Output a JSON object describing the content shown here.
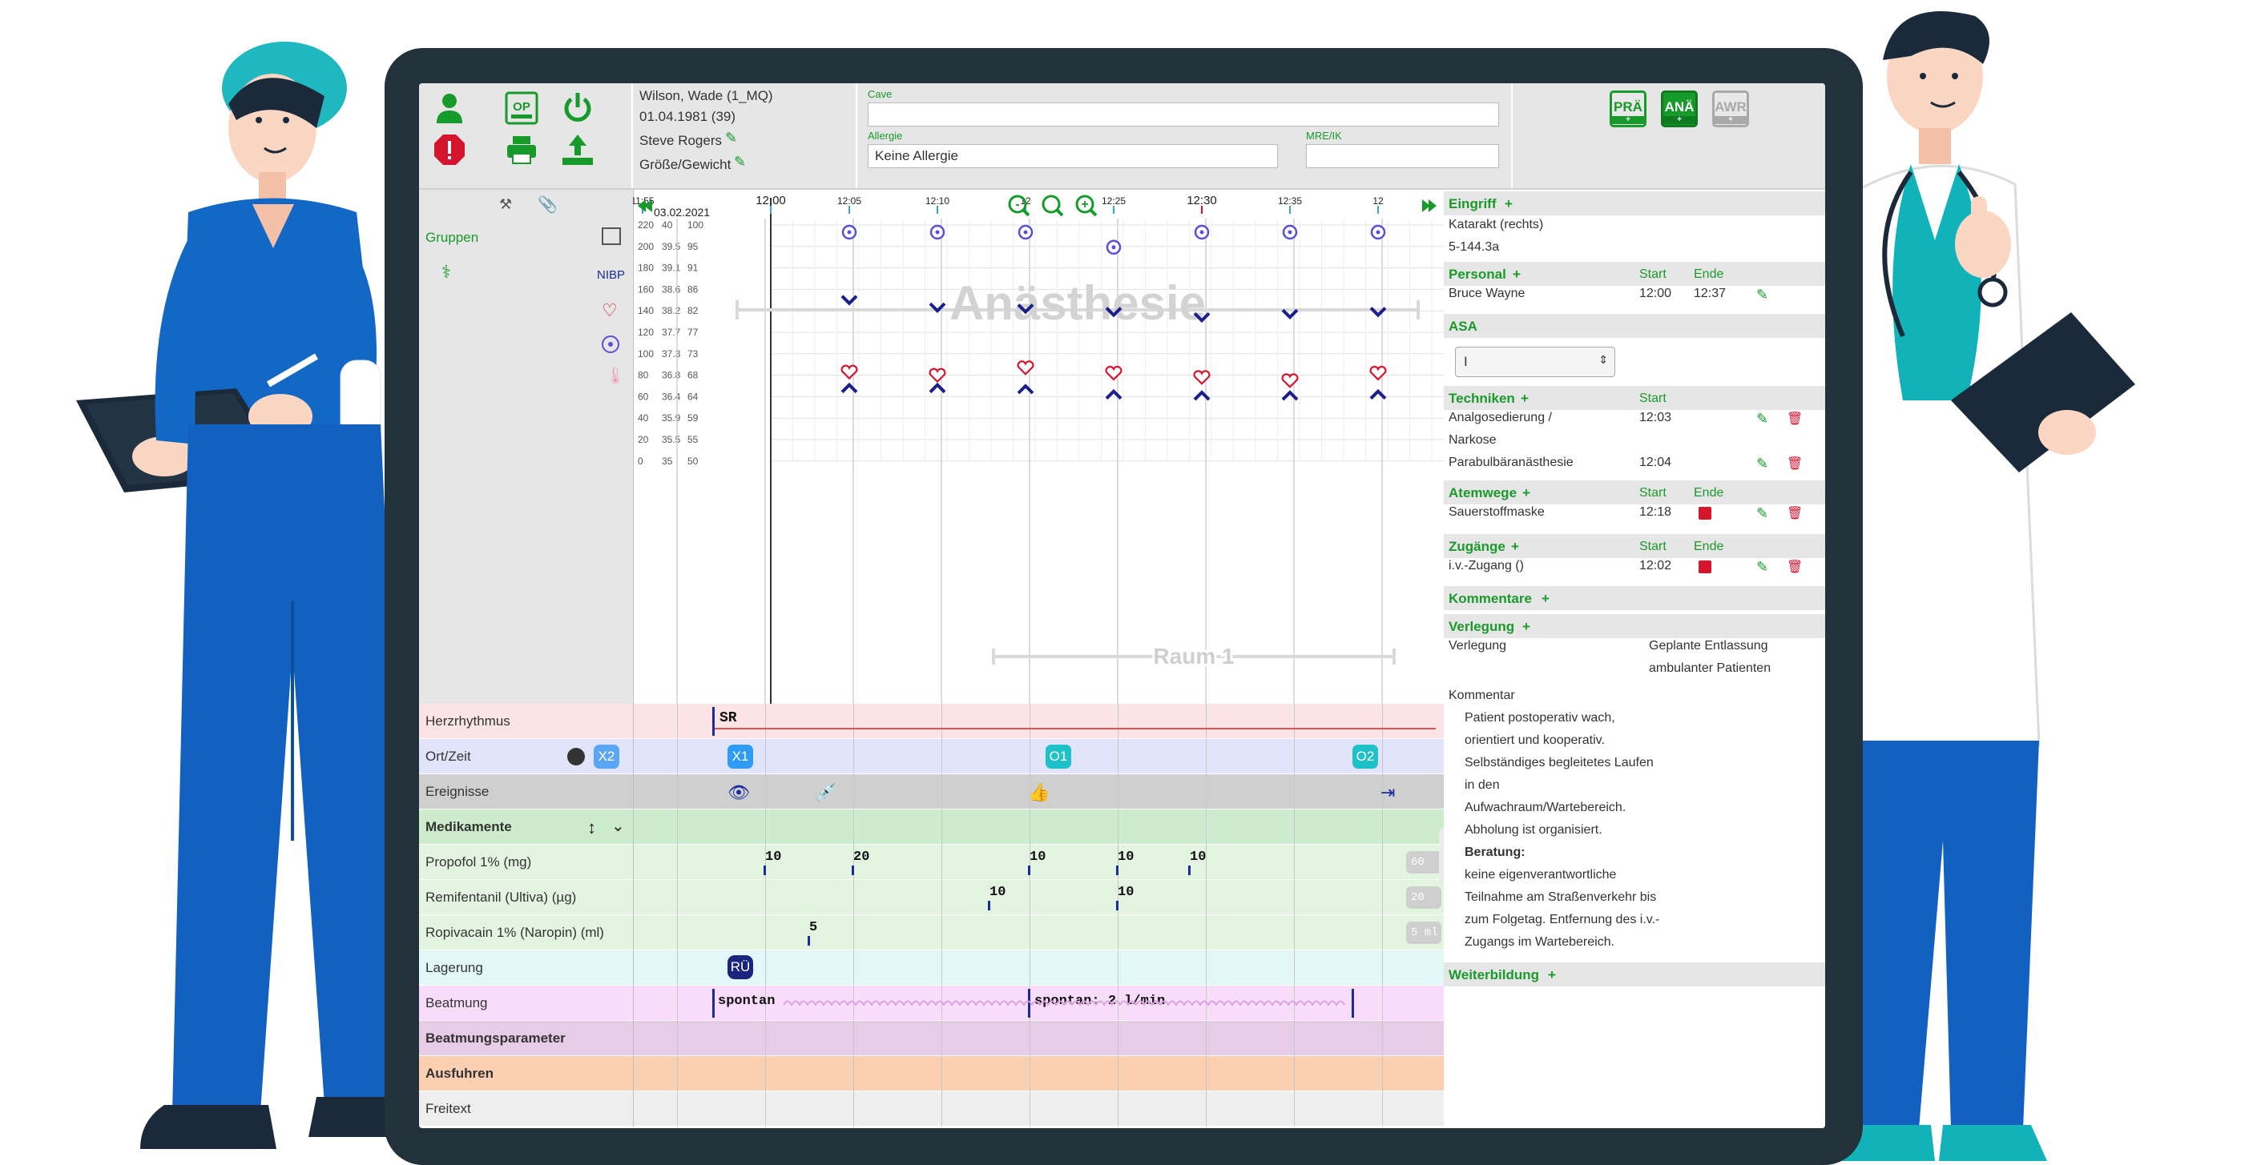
{
  "header": {
    "patient": {
      "name": "Wilson, Wade (1_MQ)",
      "dob": "01.04.1981 (39)",
      "physician": "Steve Rogers",
      "size_weight": "Größe/Gewicht"
    },
    "cave_label": "Cave",
    "cave_value": "",
    "allergie_label": "Allergie",
    "allergie_value": "Keine Allergie",
    "mre_label": "MRE/IK",
    "mre_value": "",
    "op_label": "OP",
    "phases": [
      {
        "label": "PRÄ",
        "plus": "+"
      },
      {
        "label": "ANÄ",
        "plus": "+"
      },
      {
        "label": "AWR",
        "plus": "+"
      }
    ]
  },
  "left": {
    "gruppen": "Gruppen",
    "nibp": "NIBP"
  },
  "chart": {
    "date": "03.02.2021",
    "time_labels": [
      "11:55",
      "12:00",
      "12:05",
      "12:10",
      "12",
      "12:25",
      "12:30",
      "12:35",
      "12"
    ],
    "scale_rows": [
      [
        "220",
        "40",
        "100"
      ],
      [
        "200",
        "39.5",
        "95"
      ],
      [
        "180",
        "39.1",
        "91"
      ],
      [
        "160",
        "38.6",
        "86"
      ],
      [
        "140",
        "38.2",
        "82"
      ],
      [
        "120",
        "37.7",
        "77"
      ],
      [
        "100",
        "37.3",
        "73"
      ],
      [
        "80",
        "36.8",
        "68"
      ],
      [
        "60",
        "36.4",
        "64"
      ],
      [
        "40",
        "35.9",
        "59"
      ],
      [
        "20",
        "35.5",
        "55"
      ],
      [
        "0",
        "35",
        "50"
      ]
    ],
    "watermark": "Anästhesie",
    "room": "Raum 1",
    "spo2_values": [
      100,
      100,
      100,
      100,
      99,
      100,
      100,
      100
    ],
    "sys_values": [
      150,
      143,
      142,
      139,
      134,
      137,
      139
    ],
    "dia_values": [
      68,
      68,
      67,
      62,
      61,
      61,
      62
    ],
    "hr_values": [
      83,
      80,
      87,
      82,
      78,
      75,
      82
    ]
  },
  "rows": {
    "herzrhythmus": {
      "label": "Herzrhythmus",
      "value": "SR"
    },
    "ortzeit": {
      "label": "Ort/Zeit",
      "badges": [
        "X2",
        "X1",
        "O1",
        "O2"
      ]
    },
    "ereignisse": {
      "label": "Ereignisse"
    },
    "medikamente": {
      "label": "Medikamente"
    },
    "propofol": {
      "label": "Propofol 1% (mg)",
      "doses": [
        "10",
        "20",
        "10",
        "10",
        "10"
      ],
      "pill": "60 mg"
    },
    "remifentanil": {
      "label": "Remifentanil (Ultiva) (µg)",
      "doses": [
        "10",
        "10"
      ],
      "pill": "20 µg"
    },
    "ropivacain": {
      "label": "Ropivacain 1% (Naropin) (ml)",
      "doses": [
        "5"
      ],
      "pill": "5 ml"
    },
    "lagerung": {
      "label": "Lagerung",
      "badge": "RÜ"
    },
    "beatmung": {
      "label": "Beatmung",
      "v1": "spontan",
      "v2": "spontan: 2 l/min"
    },
    "beatmungsparameter": {
      "label": "Beatmungsparameter"
    },
    "ausfuhren": {
      "label": "Ausfuhren"
    },
    "freitext": {
      "label": "Freitext"
    }
  },
  "right": {
    "eingriff": {
      "title": "Eingriff",
      "line1": "Katarakt (rechts)",
      "line2": "5-144.3a"
    },
    "personal": {
      "title": "Personal",
      "start": "Start",
      "ende": "Ende",
      "name": "Bruce Wayne",
      "t1": "12:00",
      "t2": "12:37"
    },
    "asa": {
      "title": "ASA",
      "value": "I"
    },
    "techniken": {
      "title": "Techniken",
      "start": "Start",
      "item1a": "Analgosedierung /",
      "item1b": "Narkose",
      "t1": "12:03",
      "item2": "Parabulbäranästhesie",
      "t2": "12:04"
    },
    "atemwege": {
      "title": "Atemwege",
      "start": "Start",
      "ende": "Ende",
      "item": "Sauerstoffmaske",
      "t": "12:18"
    },
    "zugaenge": {
      "title": "Zugänge",
      "start": "Start",
      "ende": "Ende",
      "item": "i.v.-Zugang ()",
      "t": "12:02"
    },
    "kommentare": {
      "title": "Kommentare"
    },
    "verlegung": {
      "title": "Verlegung",
      "key": "Verlegung",
      "val1": "Geplante Entlassung",
      "val2": "ambulanter Patienten"
    },
    "kommentar": {
      "label": "Kommentar",
      "lines": [
        "Patient postoperativ wach,",
        "orientiert und kooperativ.",
        "Selbständiges begleitetes Laufen",
        "in den",
        "Aufwachraum/Wartebereich.",
        "Abholung ist organisiert."
      ],
      "beratung": "Beratung:",
      "lines2": [
        "keine eigenverantwortliche",
        "Teilnahme am Straßenverkehr bis",
        "zum Folgetag. Entfernung des i.v.-",
        "Zugangs im Wartebereich."
      ]
    },
    "weiterbildung": {
      "title": "Weiterbildung"
    }
  }
}
